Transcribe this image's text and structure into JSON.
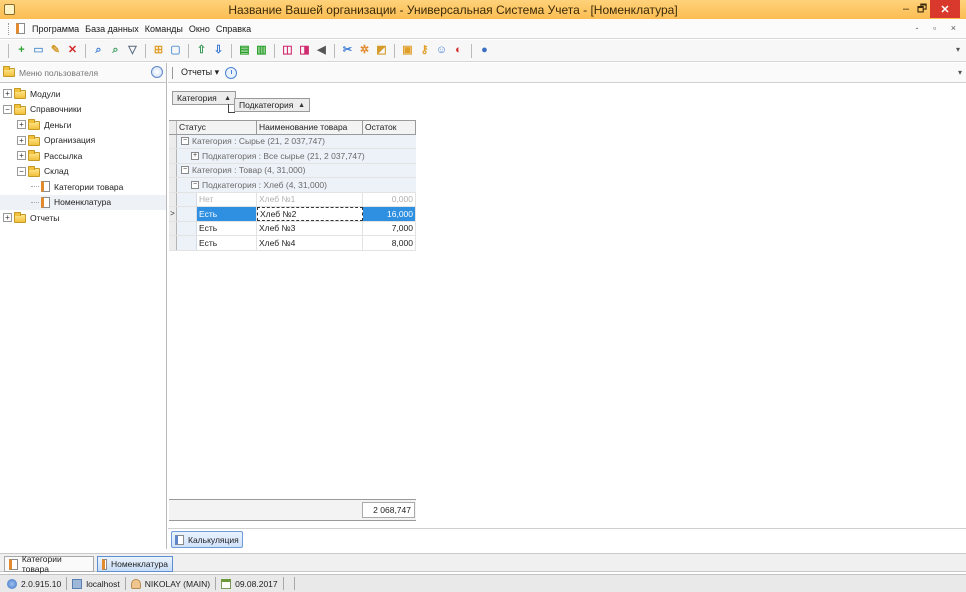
{
  "window": {
    "title": "Название Вашей организации - Универсальная Система Учета - [Номенклатура]",
    "controls": {
      "minimize": "–",
      "maximize": "🗗",
      "close": "✕"
    }
  },
  "menu": {
    "items": [
      "Программа",
      "База данных",
      "Команды",
      "Окно",
      "Справка"
    ],
    "mdi_controls": "- ▫ ×"
  },
  "toolbar": {
    "icons": [
      {
        "name": "add-icon",
        "glyph": "+",
        "color": "#2aa12a"
      },
      {
        "name": "copy-icon",
        "glyph": "▭",
        "color": "#6aa0d8"
      },
      {
        "name": "edit-icon",
        "glyph": "✎",
        "color": "#d49a2a"
      },
      {
        "name": "delete-icon",
        "glyph": "✕",
        "color": "#d12b2b"
      },
      {
        "name": "find-icon",
        "glyph": "⌕",
        "color": "#3a7bd5"
      },
      {
        "name": "find-next-icon",
        "glyph": "⌕",
        "color": "#3a9a5c"
      },
      {
        "name": "filter-icon",
        "glyph": "▽",
        "color": "#5b6b80"
      },
      {
        "name": "tree-icon",
        "glyph": "⊞",
        "color": "#e0a02a"
      },
      {
        "name": "view-icon",
        "glyph": "▢",
        "color": "#6aa0d8"
      },
      {
        "name": "move-up-icon",
        "glyph": "⇧",
        "color": "#3a9a5c"
      },
      {
        "name": "move-down-icon",
        "glyph": "⇩",
        "color": "#3a7bd5"
      },
      {
        "name": "export-icon",
        "glyph": "▤",
        "color": "#2aa12a"
      },
      {
        "name": "import-icon",
        "glyph": "▥",
        "color": "#2aa12a"
      },
      {
        "name": "window-icon",
        "glyph": "◫",
        "color": "#d12b70"
      },
      {
        "name": "window-new-icon",
        "glyph": "◨",
        "color": "#d12b70"
      },
      {
        "name": "dropdown-icon",
        "glyph": "◀",
        "color": "#555555"
      },
      {
        "name": "tools-icon",
        "glyph": "✂",
        "color": "#3a7bd5"
      },
      {
        "name": "settings-icon",
        "glyph": "✲",
        "color": "#e08a2a"
      },
      {
        "name": "chart-icon",
        "glyph": "◩",
        "color": "#d49a2a"
      },
      {
        "name": "lock-icon",
        "glyph": "▣",
        "color": "#e0a02a"
      },
      {
        "name": "key-icon",
        "glyph": "⚷",
        "color": "#e0a02a"
      },
      {
        "name": "users-icon",
        "glyph": "☺",
        "color": "#3a7bd5"
      },
      {
        "name": "palette-icon",
        "glyph": "◐",
        "color": "#d12b2b"
      },
      {
        "name": "info-icon",
        "glyph": "●",
        "color": "#3a6fc2"
      }
    ]
  },
  "left_panel": {
    "header": "Меню пользователя",
    "tree": [
      {
        "label": "Модули",
        "level": 0,
        "expander": "+",
        "kind": "folder"
      },
      {
        "label": "Справочники",
        "level": 0,
        "expander": "−",
        "kind": "folder"
      },
      {
        "label": "Деньги",
        "level": 1,
        "expander": "+",
        "kind": "folder"
      },
      {
        "label": "Организация",
        "level": 1,
        "expander": "+",
        "kind": "folder"
      },
      {
        "label": "Рассылка",
        "level": 1,
        "expander": "+",
        "kind": "folder"
      },
      {
        "label": "Склад",
        "level": 1,
        "expander": "−",
        "kind": "folder"
      },
      {
        "label": "Категории товара",
        "level": 2,
        "expander": "",
        "kind": "leaf"
      },
      {
        "label": "Номенклатура",
        "level": 2,
        "expander": "",
        "kind": "leaf",
        "selected": true
      },
      {
        "label": "Отчеты",
        "level": 0,
        "expander": "+",
        "kind": "folder"
      }
    ]
  },
  "main_toolbar": {
    "reports": "Отчеты ▾",
    "overflow": "▾"
  },
  "group_panel": {
    "category": "Категория",
    "subcategory": "Подкатегория",
    "sort_arrow": "▲"
  },
  "grid": {
    "columns": [
      "Статус",
      "Наименование товара",
      "Остаток"
    ],
    "groups": [
      {
        "label": "Категория : Сырье (21, 2 037,747)",
        "level": 1,
        "expander": "−"
      },
      {
        "label": "Подкатегория : Все сырье (21, 2 037,747)",
        "level": 2,
        "expander": "+"
      },
      {
        "label": "Категория : Товар (4, 31,000)",
        "level": 1,
        "expander": "−"
      },
      {
        "label": "Подкатегория : Хлеб (4, 31,000)",
        "level": 2,
        "expander": "−"
      }
    ],
    "rows": [
      {
        "status": "Нет",
        "name": "Хлеб №1",
        "qty": "0,000",
        "muted": true
      },
      {
        "status": "Есть",
        "name": "Хлеб №2",
        "qty": "16,000",
        "active": true
      },
      {
        "status": "Есть",
        "name": "Хлеб №3",
        "qty": "7,000"
      },
      {
        "status": "Есть",
        "name": "Хлеб №4",
        "qty": "8,000"
      }
    ],
    "row_indicator": ">",
    "total": "2 068,747"
  },
  "bottom_tab": "Калькуляция",
  "window_tabs": [
    "Категории товара",
    "Номенклатура"
  ],
  "status": {
    "version": "2.0.915.10",
    "host": "localhost",
    "user": "NIKOLAY (MAIN)",
    "date": "09.08.2017"
  },
  "colors": {
    "titlebar": "#fbbd52",
    "selection": "#2f8fe0",
    "group_row": "#edf1f8"
  }
}
